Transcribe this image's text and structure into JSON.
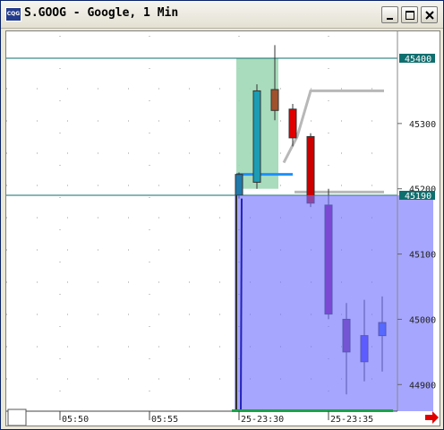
{
  "window": {
    "title": "S.GOOG - Google, 1 Min",
    "app_icon": "cqg-logo-icon"
  },
  "chart_data": {
    "type": "candlestick",
    "symbol": "S.GOOG",
    "interval": "1 Min",
    "price_ticks": [
      "45300",
      "45200",
      "45100",
      "45000",
      "44900"
    ],
    "price_tick_values": [
      45300,
      45200,
      45100,
      45000,
      44900
    ],
    "time_ticks": [
      "05:50",
      "05:55",
      "25-23:30",
      "25-23:35"
    ],
    "highlighted_levels": [
      {
        "label": "45400",
        "value": 45400,
        "color": "#0f6e6e"
      },
      {
        "label": "45190",
        "value": 45190,
        "color": "#0f6e6e"
      }
    ],
    "candles": [
      {
        "open": 45190,
        "high": 45225,
        "low": 45185,
        "close": 45222,
        "color": "#1f79ab"
      },
      {
        "open": 45210,
        "high": 45360,
        "low": 45200,
        "close": 45350,
        "color": "#1c9db5"
      },
      {
        "open": 45352,
        "high": 45420,
        "low": 45305,
        "close": 45320,
        "color": "#a0522d"
      },
      {
        "open": 45322,
        "high": 45330,
        "low": 45265,
        "close": 45278,
        "color": "#e00000"
      },
      {
        "open": 45280,
        "high": 45285,
        "low": 45172,
        "close": 45178,
        "color": "#cc0000"
      },
      {
        "open": 45175,
        "high": 45200,
        "low": 45000,
        "close": 45008,
        "color": "#8b0a8b"
      },
      {
        "open": 45000,
        "high": 45025,
        "low": 44885,
        "close": 44950,
        "color": "#7d2a8b"
      },
      {
        "open": 44975,
        "high": 45030,
        "low": 44905,
        "close": 44935,
        "color": "#4040ff"
      },
      {
        "open": 44975,
        "high": 45035,
        "low": 44920,
        "close": 44995,
        "color": "#3060ff"
      }
    ],
    "grey_line": [
      45240,
      45280,
      45350,
      45350
    ],
    "blue_line_value": 45222,
    "green_zone": {
      "from_value": 45400,
      "to_value": 45200
    },
    "blue_zone": {
      "from_value": 45190,
      "to_value": 44860
    },
    "ylim": [
      44860,
      45440
    ]
  },
  "status": {
    "scroll_right_icon": "arrow-right-icon"
  }
}
